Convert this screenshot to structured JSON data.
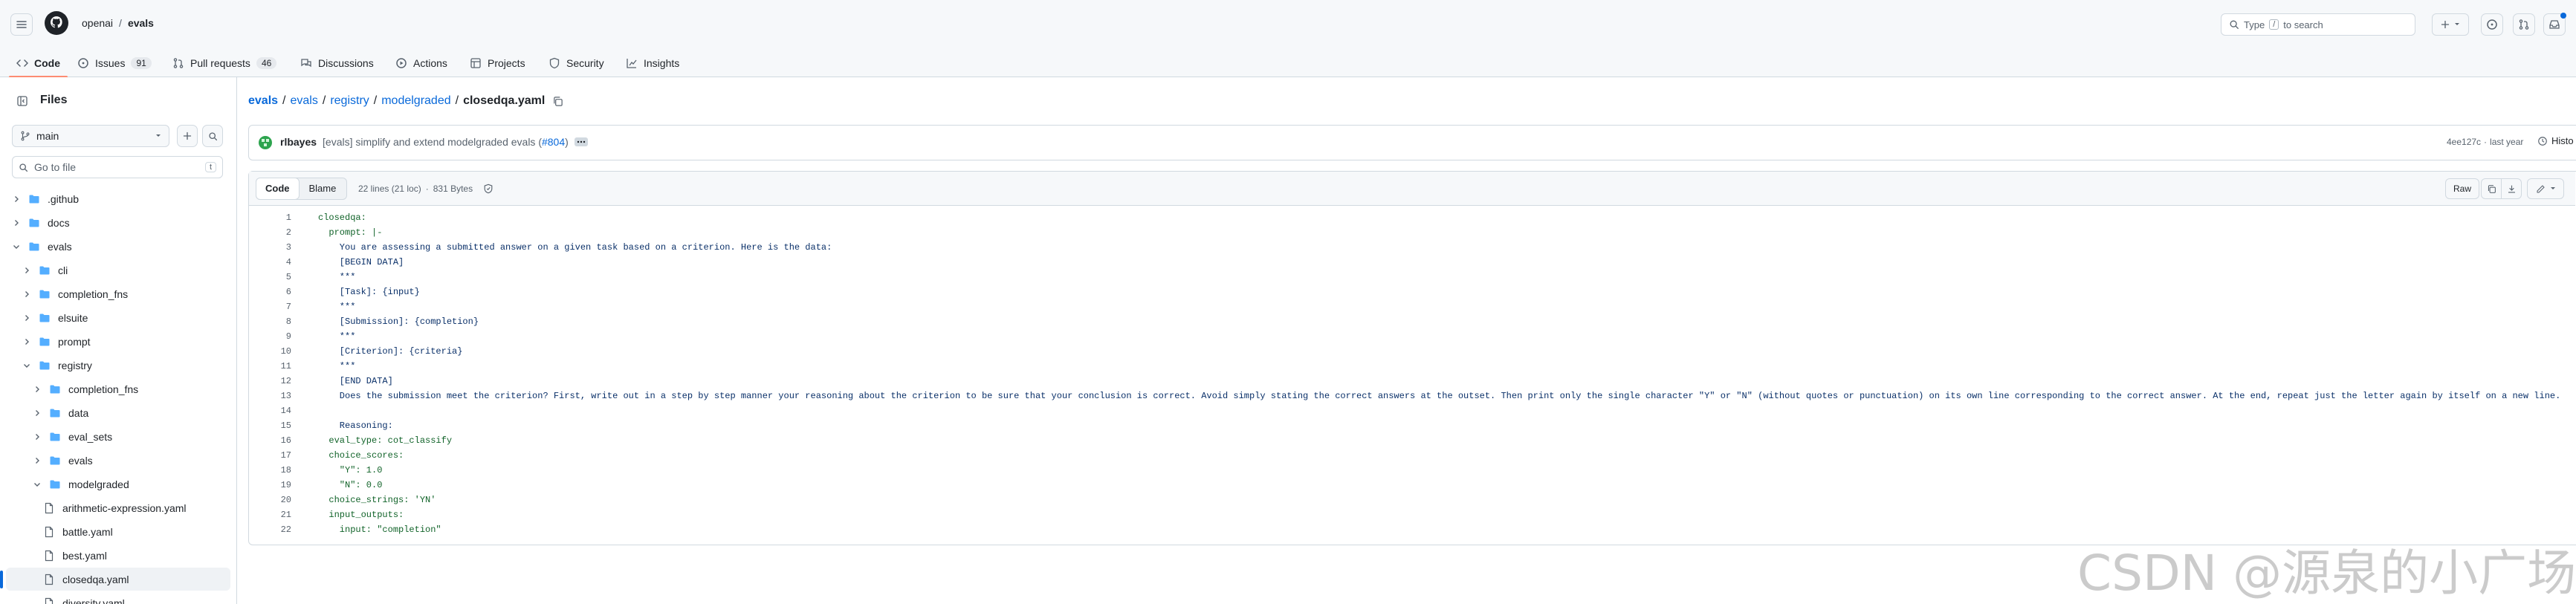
{
  "header": {
    "owner": "openai",
    "separator": "/",
    "repo": "evals",
    "search_label": "Type",
    "search_key": "/",
    "search_suffix": "to search"
  },
  "repo_nav": {
    "tabs": [
      {
        "label": "Code",
        "count": ""
      },
      {
        "label": "Issues",
        "count": "91"
      },
      {
        "label": "Pull requests",
        "count": "46"
      },
      {
        "label": "Discussions",
        "count": ""
      },
      {
        "label": "Actions",
        "count": ""
      },
      {
        "label": "Projects",
        "count": ""
      },
      {
        "label": "Security",
        "count": ""
      },
      {
        "label": "Insights",
        "count": ""
      }
    ]
  },
  "sidebar": {
    "title": "Files",
    "branch": "main",
    "goto_placeholder": "Go to file",
    "goto_shortcut": "t",
    "tree": [
      {
        "label": ".github",
        "type": "folder",
        "depth": 0,
        "open": false
      },
      {
        "label": "docs",
        "type": "folder",
        "depth": 0,
        "open": false
      },
      {
        "label": "evals",
        "type": "folder",
        "depth": 0,
        "open": true
      },
      {
        "label": "cli",
        "type": "folder",
        "depth": 1,
        "open": false
      },
      {
        "label": "completion_fns",
        "type": "folder",
        "depth": 1,
        "open": false
      },
      {
        "label": "elsuite",
        "type": "folder",
        "depth": 1,
        "open": false
      },
      {
        "label": "prompt",
        "type": "folder",
        "depth": 1,
        "open": false
      },
      {
        "label": "registry",
        "type": "folder",
        "depth": 1,
        "open": true
      },
      {
        "label": "completion_fns",
        "type": "folder",
        "depth": 2,
        "open": false
      },
      {
        "label": "data",
        "type": "folder",
        "depth": 2,
        "open": false
      },
      {
        "label": "eval_sets",
        "type": "folder",
        "depth": 2,
        "open": false
      },
      {
        "label": "evals",
        "type": "folder",
        "depth": 2,
        "open": false
      },
      {
        "label": "modelgraded",
        "type": "folder",
        "depth": 2,
        "open": true
      },
      {
        "label": "arithmetic-expression.yaml",
        "type": "file",
        "depth": 3,
        "open": false
      },
      {
        "label": "battle.yaml",
        "type": "file",
        "depth": 3,
        "open": false
      },
      {
        "label": "best.yaml",
        "type": "file",
        "depth": 3,
        "open": false
      },
      {
        "label": "closedqa.yaml",
        "type": "file",
        "depth": 3,
        "open": false,
        "selected": true
      },
      {
        "label": "diversity.yaml",
        "type": "file",
        "depth": 3,
        "open": false
      }
    ]
  },
  "breadcrumb": {
    "parts": [
      "evals",
      "evals",
      "registry",
      "modelgraded"
    ],
    "separator": "/",
    "current": "closedqa.yaml"
  },
  "commit": {
    "author": "rlbayes",
    "message": "[evals] simplify and extend modelgraded evals (",
    "pr": "#804",
    "message_end": ")",
    "hash": "4ee127c",
    "age_sep": "·",
    "age": "last year",
    "history_label": "Histo"
  },
  "file_toolbar": {
    "code_tab": "Code",
    "blame_tab": "Blame",
    "lines_info": "22 lines (21 loc)",
    "size_sep": "·",
    "size_info": "831 Bytes",
    "raw_label": "Raw"
  },
  "code": {
    "lines": [
      {
        "n": "1",
        "text": "closedqa:",
        "kind": "k"
      },
      {
        "n": "2",
        "text": "  prompt: |-",
        "kind": "k"
      },
      {
        "n": "3",
        "text": "    You are assessing a submitted answer on a given task based on a criterion. Here is the data:",
        "kind": "s"
      },
      {
        "n": "4",
        "text": "    [BEGIN DATA]",
        "kind": "s"
      },
      {
        "n": "5",
        "text": "    ***",
        "kind": "s"
      },
      {
        "n": "6",
        "text": "    [Task]: {input}",
        "kind": "s"
      },
      {
        "n": "7",
        "text": "    ***",
        "kind": "s"
      },
      {
        "n": "8",
        "text": "    [Submission]: {completion}",
        "kind": "s"
      },
      {
        "n": "9",
        "text": "    ***",
        "kind": "s"
      },
      {
        "n": "10",
        "text": "    [Criterion]: {criteria}",
        "kind": "s"
      },
      {
        "n": "11",
        "text": "    ***",
        "kind": "s"
      },
      {
        "n": "12",
        "text": "    [END DATA]",
        "kind": "s"
      },
      {
        "n": "13",
        "text": "    Does the submission meet the criterion? First, write out in a step by step manner your reasoning about the criterion to be sure that your conclusion is correct. Avoid simply stating the correct answers at the outset. Then print only the single character \"Y\" or \"N\" (without quotes or punctuation) on its own line corresponding to the correct answer. At the end, repeat just the letter again by itself on a new line.",
        "kind": "s"
      },
      {
        "n": "14",
        "text": "",
        "kind": "s"
      },
      {
        "n": "15",
        "text": "    Reasoning:",
        "kind": "s"
      },
      {
        "n": "16",
        "text": "  eval_type: cot_classify",
        "kind": "k"
      },
      {
        "n": "17",
        "text": "  choice_scores:",
        "kind": "k"
      },
      {
        "n": "18",
        "text": "    \"Y\": 1.0",
        "kind": "k"
      },
      {
        "n": "19",
        "text": "    \"N\": 0.0",
        "kind": "k"
      },
      {
        "n": "20",
        "text": "  choice_strings: 'YN'",
        "kind": "k"
      },
      {
        "n": "21",
        "text": "  input_outputs:",
        "kind": "k"
      },
      {
        "n": "22",
        "text": "    input: \"completion\"",
        "kind": "k"
      }
    ]
  },
  "watermark": "CSDN @源泉的小广场",
  "colors": {
    "accent": "#0969da",
    "tab_underline": "#fd8c73",
    "yaml_key": "#116329",
    "yaml_string": "#0a3069",
    "yaml_number": "#0550ae"
  }
}
